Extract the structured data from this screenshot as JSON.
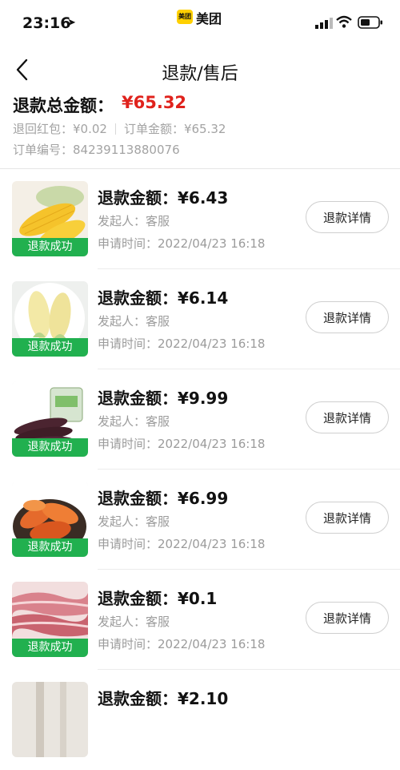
{
  "status_bar": {
    "time": "23:16",
    "location_icon": "location-arrow-icon",
    "app_badge": "美团",
    "app_name": "美团"
  },
  "nav": {
    "title": "退款/售后",
    "back_icon": "back-chevron-icon"
  },
  "summary": {
    "total_label": "退款总金额：",
    "total_value": "¥65.32",
    "red_packet": "退回红包：¥0.02",
    "order_amount": "订单金额：¥65.32",
    "order_no": "订单编号：84239113880076"
  },
  "refunds": [
    {
      "thumb": "corn-yellow",
      "status": "退款成功",
      "amount": "退款金额：¥6.43",
      "initiator": "发起人：客服",
      "time": "申请时间：2022/04/23 16:18",
      "button": "退款详情"
    },
    {
      "thumb": "corn-white",
      "status": "退款成功",
      "amount": "退款金额：¥6.14",
      "initiator": "发起人：客服",
      "time": "申请时间：2022/04/23 16:18",
      "button": "退款详情"
    },
    {
      "thumb": "corn-purple",
      "status": "退款成功",
      "amount": "退款金额：¥9.99",
      "initiator": "发起人：客服",
      "time": "申请时间：2022/04/23 16:18",
      "button": "退款详情"
    },
    {
      "thumb": "sweet-potato",
      "status": "退款成功",
      "amount": "退款金额：¥6.99",
      "initiator": "发起人：客服",
      "time": "申请时间：2022/04/23 16:18",
      "button": "退款详情"
    },
    {
      "thumb": "meat-slices",
      "status": "退款成功",
      "amount": "退款金额：¥0.1",
      "initiator": "发起人：客服",
      "time": "申请时间：2022/04/23 16:18",
      "button": "退款详情"
    },
    {
      "thumb": "partial",
      "status": "",
      "amount": "退款金额：¥2.10",
      "initiator": "",
      "time": "",
      "button": ""
    }
  ]
}
